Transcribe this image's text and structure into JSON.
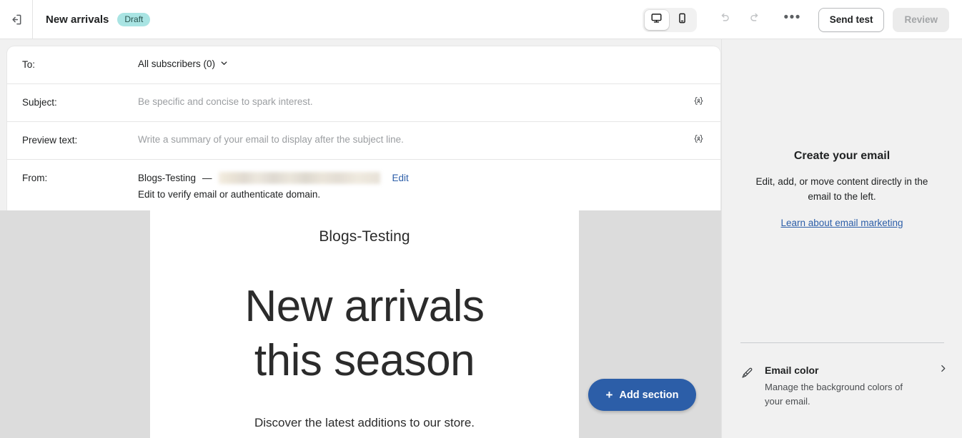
{
  "topbar": {
    "exit_icon": "exit-icon",
    "title": "New arrivals",
    "status_badge": "Draft",
    "device_toggle": {
      "desktop_icon": "desktop-icon",
      "mobile_icon": "mobile-icon",
      "selected": "desktop"
    },
    "undo_icon": "undo-icon",
    "redo_icon": "redo-icon",
    "more_label": "•••",
    "send_test_label": "Send test",
    "review_label": "Review"
  },
  "email_header": {
    "to": {
      "label": "To:",
      "value": "All subscribers (0)",
      "chevron_icon": "chevron-down-icon"
    },
    "subject": {
      "label": "Subject:",
      "placeholder": "Be specific and concise to spark interest.",
      "value": "",
      "variable_icon": "personalization-variable-icon"
    },
    "preview_text": {
      "label": "Preview text:",
      "placeholder": "Write a summary of your email to display after the subject line.",
      "value": "",
      "variable_icon": "personalization-variable-icon"
    },
    "from": {
      "label": "From:",
      "name": "Blogs-Testing",
      "separator": "—",
      "email_redacted": "",
      "edit_label": "Edit",
      "note": "Edit to verify email or authenticate domain."
    }
  },
  "email_preview": {
    "brand": "Blogs-Testing",
    "heading_line_1": "New arrivals",
    "heading_line_2": "this season",
    "subtext": "Discover the latest additions to our store."
  },
  "add_section": {
    "plus": "+",
    "label": "Add section"
  },
  "sidebar": {
    "intro_title": "Create your email",
    "intro_text": "Edit, add, or move content directly in the email to the left.",
    "intro_link": "Learn about email marketing",
    "email_color": {
      "icon": "paintbrush-icon",
      "title": "Email color",
      "description": "Manage the background colors of your email.",
      "chevron_icon": "chevron-right-icon"
    }
  },
  "colors": {
    "accent_blue": "#2c5ea8",
    "badge_teal": "#a9e4e3",
    "canvas_gray": "#dcdcdc",
    "sidebar_gray": "#f1f1f1"
  }
}
